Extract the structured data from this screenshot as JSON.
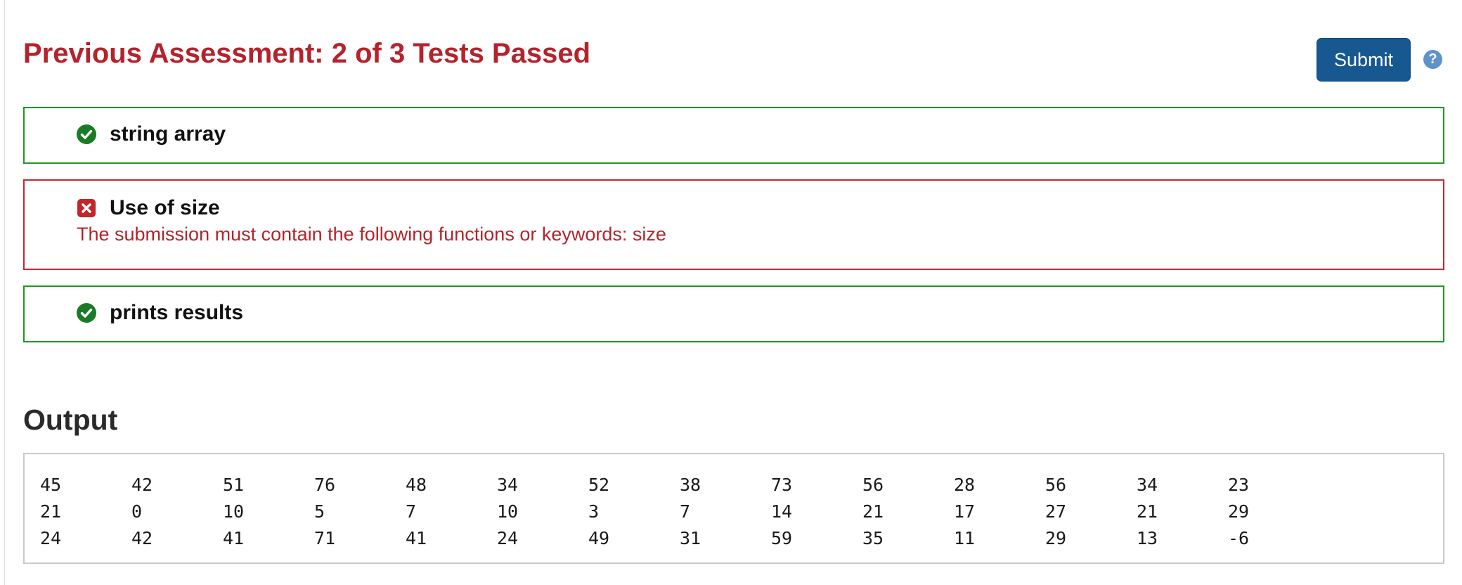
{
  "header": {
    "title": "Previous Assessment: 2 of 3 Tests Passed",
    "submit_label": "Submit",
    "help_glyph": "?"
  },
  "colors": {
    "fail": "#b4232c",
    "pass": "#1b9a22",
    "submit": "#16588f"
  },
  "tests": [
    {
      "name": "string array",
      "status": "pass",
      "icon": "check-circle-icon",
      "message": ""
    },
    {
      "name": "Use of size",
      "status": "fail",
      "icon": "x-square-icon",
      "message": "The submission must contain the following functions or keywords: size"
    },
    {
      "name": "prints results",
      "status": "pass",
      "icon": "check-circle-icon",
      "message": ""
    }
  ],
  "output": {
    "heading": "Output",
    "rows": [
      [
        "45",
        "42",
        "51",
        "76",
        "48",
        "34",
        "52",
        "38",
        "73",
        "56",
        "28",
        "56",
        "34",
        "23"
      ],
      [
        "21",
        "0",
        "10",
        "5",
        "7",
        "10",
        "3",
        "7",
        "14",
        "21",
        "17",
        "27",
        "21",
        "29"
      ],
      [
        "24",
        "42",
        "41",
        "71",
        "41",
        "24",
        "49",
        "31",
        "59",
        "35",
        "11",
        "29",
        "13",
        "-6"
      ]
    ]
  }
}
